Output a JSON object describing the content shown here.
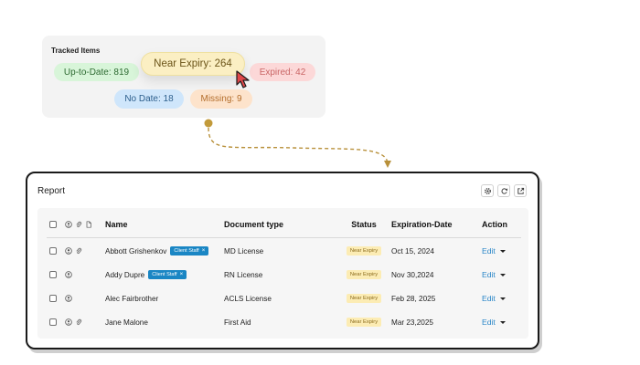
{
  "tracked": {
    "title": "Tracked Items",
    "pills": {
      "up_to_date": "Up-to-Date: 819",
      "near_expiry": "Near Expiry: 264",
      "expired": "Expired: 42",
      "no_date": "No Date: 18",
      "missing": "Missing: 9"
    }
  },
  "report": {
    "title": "Report",
    "toolbar": [
      "gear-icon",
      "refresh-icon",
      "export-icon"
    ],
    "columns": {
      "name": "Name",
      "document_type": "Document type",
      "status": "Status",
      "expiration_date": "Expiration-Date",
      "action": "Action"
    },
    "rows": [
      {
        "name": "Abbott Grishenkov",
        "tag": "Client Staff",
        "tag_close": "×",
        "document_type": "MD License",
        "status": "Near Expiry",
        "expiration_date": "Oct 15, 2024",
        "action": "Edit",
        "has_attachment": true
      },
      {
        "name": "Addy Dupre",
        "tag": "Client Staff",
        "tag_close": "×",
        "document_type": "RN License",
        "status": "Near Expiry",
        "expiration_date": "Nov 30,2024",
        "action": "Edit",
        "has_attachment": false
      },
      {
        "name": "Alec Fairbrother",
        "tag": "",
        "tag_close": "",
        "document_type": "ACLS License",
        "status": "Near Expiry",
        "expiration_date": "Feb 28, 2025",
        "action": "Edit",
        "has_attachment": false
      },
      {
        "name": "Jane Malone",
        "tag": "",
        "tag_close": "",
        "document_type": "First Aid",
        "status": "Near Expiry",
        "expiration_date": "Mar 23,2025",
        "action": "Edit",
        "has_attachment": true
      }
    ]
  },
  "colors": {
    "accent_blue": "#1a86c4",
    "connector": "#b8903a",
    "near_expiry_bg": "#fcecb4"
  }
}
